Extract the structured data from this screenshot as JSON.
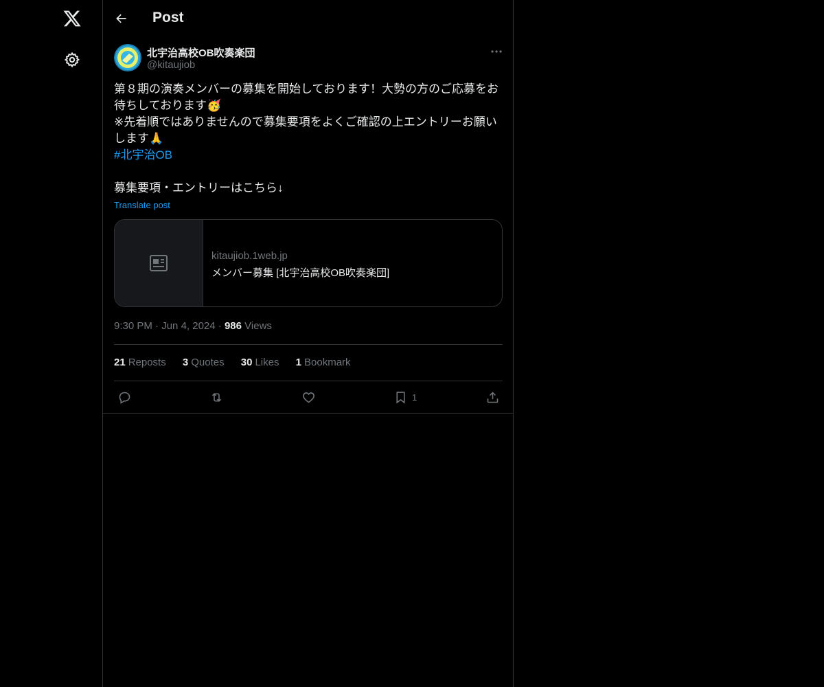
{
  "nav": {
    "logo_icon": "x-logo-icon",
    "settings_icon": "gear-icon"
  },
  "header": {
    "title": "Post"
  },
  "author": {
    "name": "北宇治高校OB吹奏楽団",
    "handle": "@kitaujiob"
  },
  "post": {
    "lines": [
      "第８期の演奏メンバーの募集を開始しております！大勢の方のご応募をお",
      "待ちしております🥳",
      "※先着順ではありませんので募集要項をよくご確認の上エントリーお願い",
      "します🙏"
    ],
    "hashtag": "#北宇治OB",
    "entry_line": "募集要項・エントリーはこちら↓",
    "translate": "Translate post"
  },
  "card": {
    "domain": "kitaujiob.1web.jp",
    "title": "メンバー募集 [北宇治高校OB吹奏楽団]"
  },
  "meta": {
    "time": "9:30 PM",
    "date": "Jun 4, 2024",
    "views_count": "986",
    "views_label": "Views"
  },
  "stats": {
    "reposts_count": "21",
    "reposts_label": "Reposts",
    "quotes_count": "3",
    "quotes_label": "Quotes",
    "likes_count": "30",
    "likes_label": "Likes",
    "bookmarks_count": "1",
    "bookmarks_label": "Bookmark"
  },
  "actions": {
    "bookmark_count": "1"
  },
  "colors": {
    "background": "#000000",
    "accent": "#1d9bf0",
    "muted": "#71767b",
    "border": "#2f3336"
  }
}
